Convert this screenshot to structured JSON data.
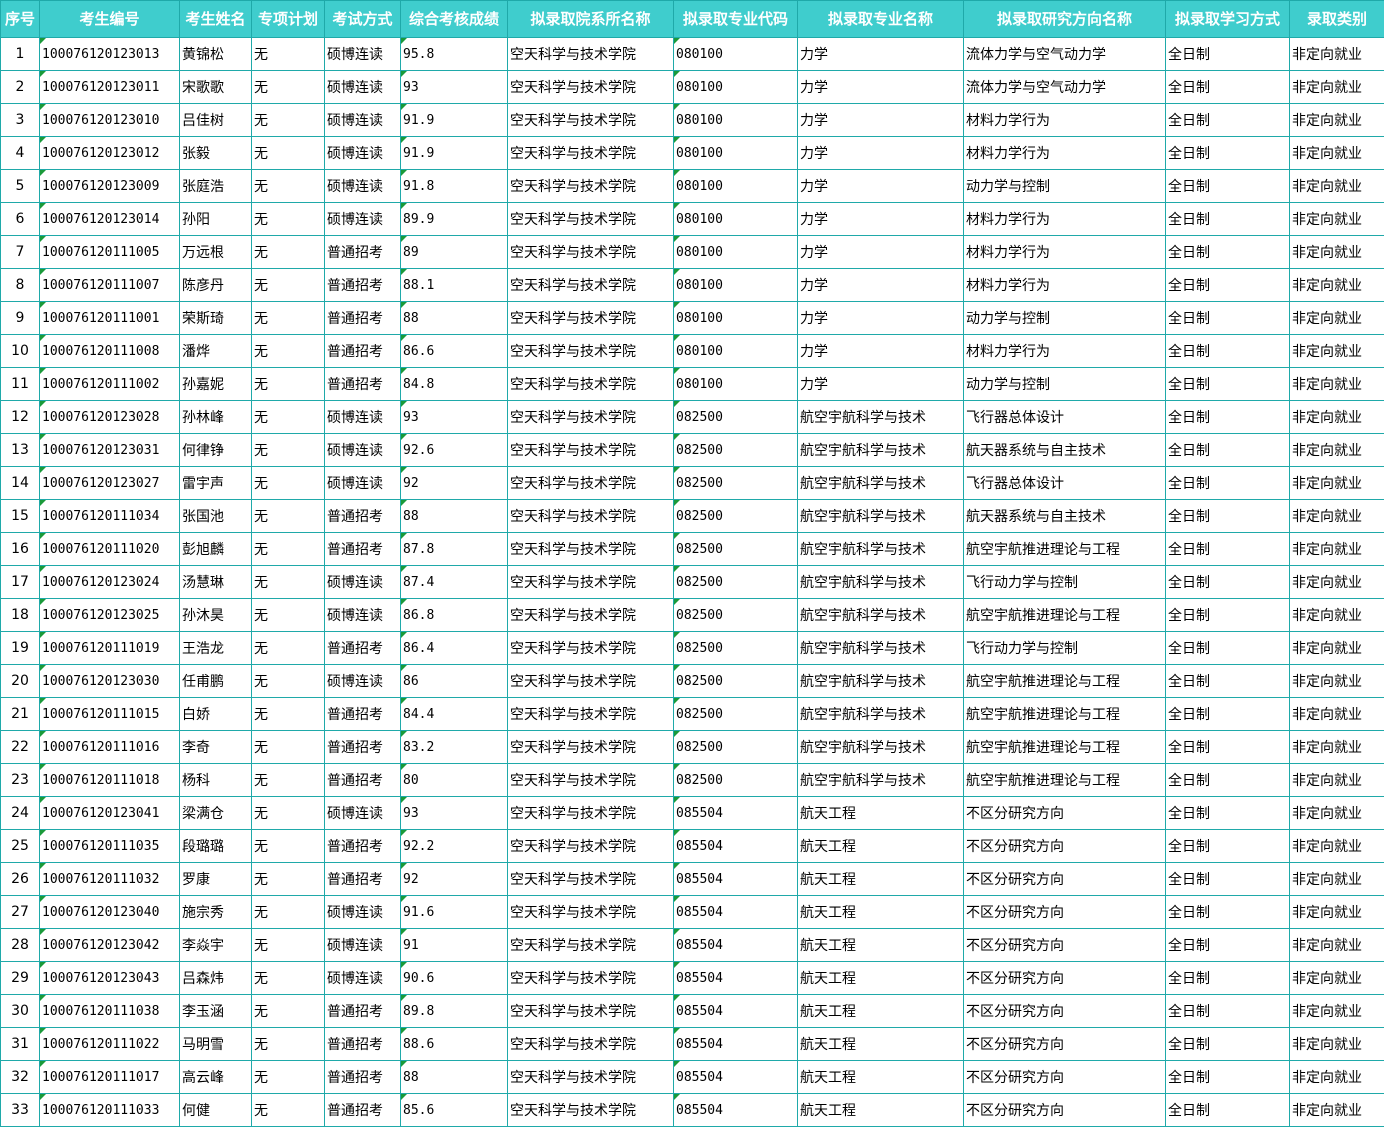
{
  "headers": [
    "序号",
    "考生编号",
    "考生姓名",
    "专项计划",
    "考试方式",
    "综合考核成绩",
    "拟录取院系所名称",
    "拟录取专业代码",
    "拟录取专业名称",
    "拟录取研究方向名称",
    "拟录取学习方式",
    "录取类别"
  ],
  "rows": [
    [
      "1",
      "100076120123013",
      "黄锦松",
      "无",
      "硕博连读",
      "95.8",
      "空天科学与技术学院",
      "080100",
      "力学",
      "流体力学与空气动力学",
      "全日制",
      "非定向就业"
    ],
    [
      "2",
      "100076120123011",
      "宋歌歌",
      "无",
      "硕博连读",
      "93",
      "空天科学与技术学院",
      "080100",
      "力学",
      "流体力学与空气动力学",
      "全日制",
      "非定向就业"
    ],
    [
      "3",
      "100076120123010",
      "吕佳树",
      "无",
      "硕博连读",
      "91.9",
      "空天科学与技术学院",
      "080100",
      "力学",
      "材料力学行为",
      "全日制",
      "非定向就业"
    ],
    [
      "4",
      "100076120123012",
      "张毅",
      "无",
      "硕博连读",
      "91.9",
      "空天科学与技术学院",
      "080100",
      "力学",
      "材料力学行为",
      "全日制",
      "非定向就业"
    ],
    [
      "5",
      "100076120123009",
      "张庭浩",
      "无",
      "硕博连读",
      "91.8",
      "空天科学与技术学院",
      "080100",
      "力学",
      "动力学与控制",
      "全日制",
      "非定向就业"
    ],
    [
      "6",
      "100076120123014",
      "孙阳",
      "无",
      "硕博连读",
      "89.9",
      "空天科学与技术学院",
      "080100",
      "力学",
      "材料力学行为",
      "全日制",
      "非定向就业"
    ],
    [
      "7",
      "100076120111005",
      "万远根",
      "无",
      "普通招考",
      "89",
      "空天科学与技术学院",
      "080100",
      "力学",
      "材料力学行为",
      "全日制",
      "非定向就业"
    ],
    [
      "8",
      "100076120111007",
      "陈彦丹",
      "无",
      "普通招考",
      "88.1",
      "空天科学与技术学院",
      "080100",
      "力学",
      "材料力学行为",
      "全日制",
      "非定向就业"
    ],
    [
      "9",
      "100076120111001",
      "荣斯琦",
      "无",
      "普通招考",
      "88",
      "空天科学与技术学院",
      "080100",
      "力学",
      "动力学与控制",
      "全日制",
      "非定向就业"
    ],
    [
      "10",
      "100076120111008",
      "潘烨",
      "无",
      "普通招考",
      "86.6",
      "空天科学与技术学院",
      "080100",
      "力学",
      "材料力学行为",
      "全日制",
      "非定向就业"
    ],
    [
      "11",
      "100076120111002",
      "孙嘉妮",
      "无",
      "普通招考",
      "84.8",
      "空天科学与技术学院",
      "080100",
      "力学",
      "动力学与控制",
      "全日制",
      "非定向就业"
    ],
    [
      "12",
      "100076120123028",
      "孙林峰",
      "无",
      "硕博连读",
      "93",
      "空天科学与技术学院",
      "082500",
      "航空宇航科学与技术",
      "飞行器总体设计",
      "全日制",
      "非定向就业"
    ],
    [
      "13",
      "100076120123031",
      "何律铮",
      "无",
      "硕博连读",
      "92.6",
      "空天科学与技术学院",
      "082500",
      "航空宇航科学与技术",
      "航天器系统与自主技术",
      "全日制",
      "非定向就业"
    ],
    [
      "14",
      "100076120123027",
      "雷宇声",
      "无",
      "硕博连读",
      "92",
      "空天科学与技术学院",
      "082500",
      "航空宇航科学与技术",
      "飞行器总体设计",
      "全日制",
      "非定向就业"
    ],
    [
      "15",
      "100076120111034",
      "张国池",
      "无",
      "普通招考",
      "88",
      "空天科学与技术学院",
      "082500",
      "航空宇航科学与技术",
      "航天器系统与自主技术",
      "全日制",
      "非定向就业"
    ],
    [
      "16",
      "100076120111020",
      "彭旭麟",
      "无",
      "普通招考",
      "87.8",
      "空天科学与技术学院",
      "082500",
      "航空宇航科学与技术",
      "航空宇航推进理论与工程",
      "全日制",
      "非定向就业"
    ],
    [
      "17",
      "100076120123024",
      "汤慧琳",
      "无",
      "硕博连读",
      "87.4",
      "空天科学与技术学院",
      "082500",
      "航空宇航科学与技术",
      "飞行动力学与控制",
      "全日制",
      "非定向就业"
    ],
    [
      "18",
      "100076120123025",
      "孙沐昊",
      "无",
      "硕博连读",
      "86.8",
      "空天科学与技术学院",
      "082500",
      "航空宇航科学与技术",
      "航空宇航推进理论与工程",
      "全日制",
      "非定向就业"
    ],
    [
      "19",
      "100076120111019",
      "王浩龙",
      "无",
      "普通招考",
      "86.4",
      "空天科学与技术学院",
      "082500",
      "航空宇航科学与技术",
      "飞行动力学与控制",
      "全日制",
      "非定向就业"
    ],
    [
      "20",
      "100076120123030",
      "任甫鹏",
      "无",
      "硕博连读",
      "86",
      "空天科学与技术学院",
      "082500",
      "航空宇航科学与技术",
      "航空宇航推进理论与工程",
      "全日制",
      "非定向就业"
    ],
    [
      "21",
      "100076120111015",
      "白娇",
      "无",
      "普通招考",
      "84.4",
      "空天科学与技术学院",
      "082500",
      "航空宇航科学与技术",
      "航空宇航推进理论与工程",
      "全日制",
      "非定向就业"
    ],
    [
      "22",
      "100076120111016",
      "李奇",
      "无",
      "普通招考",
      "83.2",
      "空天科学与技术学院",
      "082500",
      "航空宇航科学与技术",
      "航空宇航推进理论与工程",
      "全日制",
      "非定向就业"
    ],
    [
      "23",
      "100076120111018",
      "杨科",
      "无",
      "普通招考",
      "80",
      "空天科学与技术学院",
      "082500",
      "航空宇航科学与技术",
      "航空宇航推进理论与工程",
      "全日制",
      "非定向就业"
    ],
    [
      "24",
      "100076120123041",
      "梁满仓",
      "无",
      "硕博连读",
      "93",
      "空天科学与技术学院",
      "085504",
      "航天工程",
      "不区分研究方向",
      "全日制",
      "非定向就业"
    ],
    [
      "25",
      "100076120111035",
      "段璐璐",
      "无",
      "普通招考",
      "92.2",
      "空天科学与技术学院",
      "085504",
      "航天工程",
      "不区分研究方向",
      "全日制",
      "非定向就业"
    ],
    [
      "26",
      "100076120111032",
      "罗康",
      "无",
      "普通招考",
      "92",
      "空天科学与技术学院",
      "085504",
      "航天工程",
      "不区分研究方向",
      "全日制",
      "非定向就业"
    ],
    [
      "27",
      "100076120123040",
      "施宗秀",
      "无",
      "硕博连读",
      "91.6",
      "空天科学与技术学院",
      "085504",
      "航天工程",
      "不区分研究方向",
      "全日制",
      "非定向就业"
    ],
    [
      "28",
      "100076120123042",
      "李焱宇",
      "无",
      "硕博连读",
      "91",
      "空天科学与技术学院",
      "085504",
      "航天工程",
      "不区分研究方向",
      "全日制",
      "非定向就业"
    ],
    [
      "29",
      "100076120123043",
      "吕森炜",
      "无",
      "硕博连读",
      "90.6",
      "空天科学与技术学院",
      "085504",
      "航天工程",
      "不区分研究方向",
      "全日制",
      "非定向就业"
    ],
    [
      "30",
      "100076120111038",
      "李玉涵",
      "无",
      "普通招考",
      "89.8",
      "空天科学与技术学院",
      "085504",
      "航天工程",
      "不区分研究方向",
      "全日制",
      "非定向就业"
    ],
    [
      "31",
      "100076120111022",
      "马明雪",
      "无",
      "普通招考",
      "88.6",
      "空天科学与技术学院",
      "085504",
      "航天工程",
      "不区分研究方向",
      "全日制",
      "非定向就业"
    ],
    [
      "32",
      "100076120111017",
      "高云峰",
      "无",
      "普通招考",
      "88",
      "空天科学与技术学院",
      "085504",
      "航天工程",
      "不区分研究方向",
      "全日制",
      "非定向就业"
    ],
    [
      "33",
      "100076120111033",
      "何健",
      "无",
      "普通招考",
      "85.6",
      "空天科学与技术学院",
      "085504",
      "航天工程",
      "不区分研究方向",
      "全日制",
      "非定向就业"
    ]
  ]
}
